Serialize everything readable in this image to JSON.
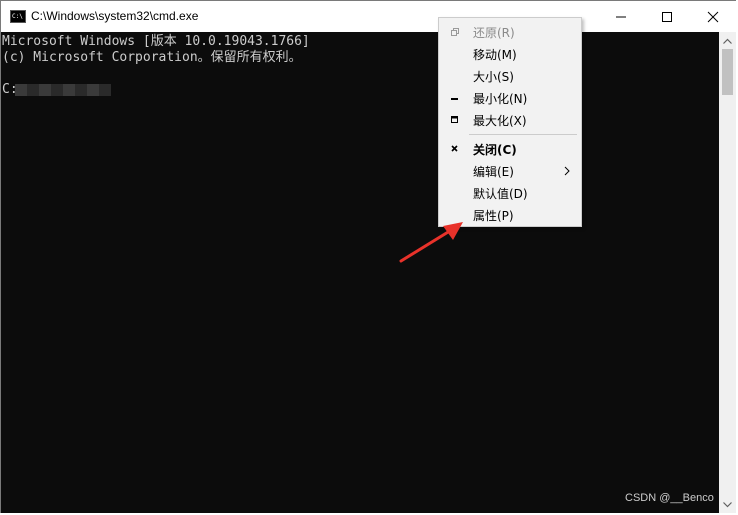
{
  "window": {
    "title": "C:\\Windows\\system32\\cmd.exe",
    "icon_label": "C:\\"
  },
  "console": {
    "line1": "Microsoft Windows [版本 10.0.19043.1766]",
    "line2": "(c) Microsoft Corporation。保留所有权利。",
    "prompt": "C:"
  },
  "menu": {
    "items": [
      {
        "label": "还原(R)",
        "icon": "restore-icon",
        "disabled": true
      },
      {
        "label": "移动(M)",
        "icon": "",
        "disabled": false
      },
      {
        "label": "大小(S)",
        "icon": "",
        "disabled": false
      },
      {
        "label": "最小化(N)",
        "icon": "minimize-icon",
        "disabled": false
      },
      {
        "label": "最大化(X)",
        "icon": "maximize-icon",
        "disabled": false
      },
      {
        "label": "关闭(C)",
        "icon": "close-icon",
        "bold": true
      },
      {
        "label": "编辑(E)",
        "icon": "",
        "submenu": true
      },
      {
        "label": "默认值(D)",
        "icon": ""
      },
      {
        "label": "属性(P)",
        "icon": ""
      }
    ]
  },
  "watermark": "CSDN @__Benco",
  "colors": {
    "console_bg": "#0c0c0c",
    "console_text": "#cccccc",
    "menu_bg": "#f2f2f2",
    "annotation_arrow": "#e8322a"
  }
}
